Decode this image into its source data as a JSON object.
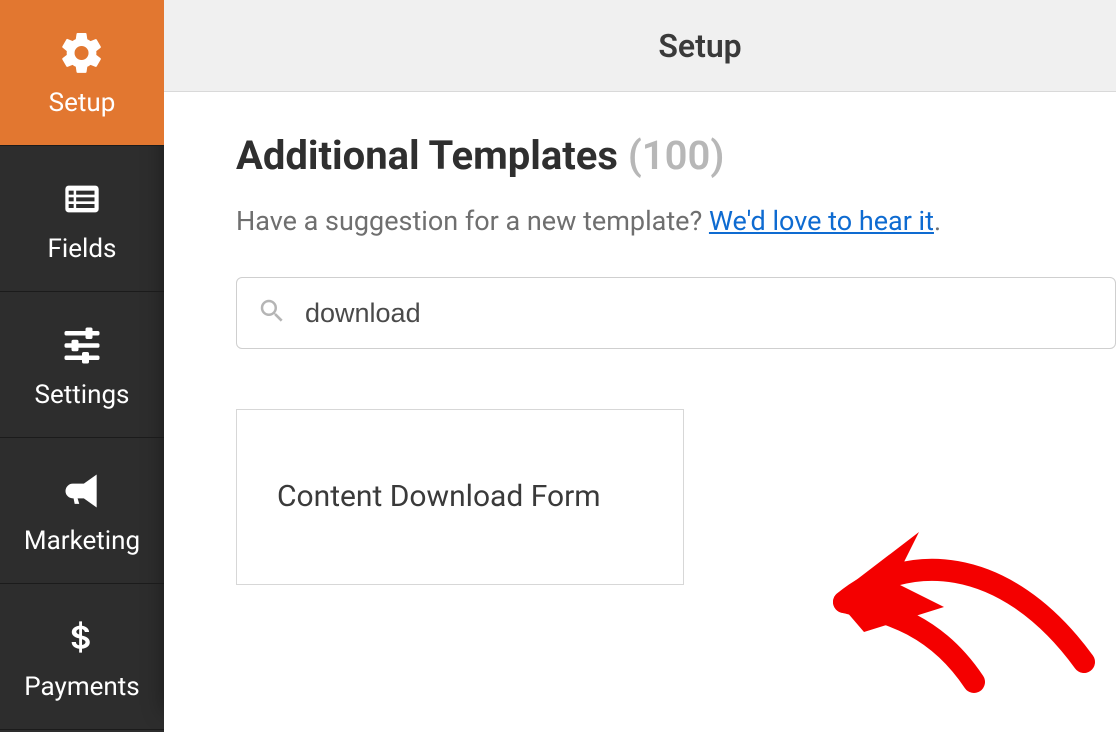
{
  "sidebar": {
    "items": [
      {
        "label": "Setup",
        "icon": "gear-icon",
        "active": true
      },
      {
        "label": "Fields",
        "icon": "list-icon",
        "active": false
      },
      {
        "label": "Settings",
        "icon": "sliders-icon",
        "active": false
      },
      {
        "label": "Marketing",
        "icon": "bullhorn-icon",
        "active": false
      },
      {
        "label": "Payments",
        "icon": "dollar-icon",
        "active": false
      }
    ]
  },
  "header": {
    "title": "Setup"
  },
  "page": {
    "heading": "Additional Templates",
    "count": "(100)",
    "subtext": "Have a suggestion for a new template? ",
    "link_text": "We'd love to hear it",
    "tail": "."
  },
  "search": {
    "value": "download"
  },
  "templates": [
    {
      "title": "Content Download Form"
    }
  ]
}
